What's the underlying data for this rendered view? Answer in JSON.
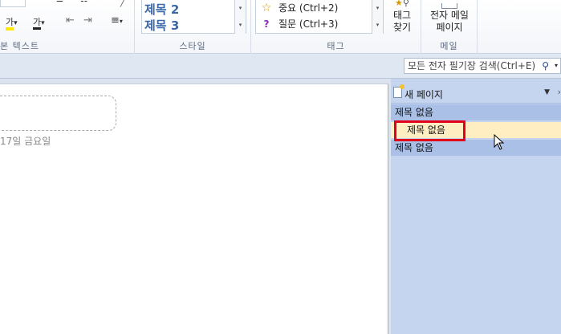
{
  "ribbon": {
    "basic_text": {
      "label": "본 텍스트",
      "highlight_glyph": "가",
      "fontcolor_glyph": "가",
      "dropdown": "▾"
    },
    "styles": {
      "label": "스타일",
      "items": [
        "제목 2",
        "제목 3"
      ]
    },
    "tags": {
      "label": "태그",
      "items": [
        {
          "icon": "star-icon",
          "glyph": "☆",
          "text": "중요 (Ctrl+2)",
          "color": "#d49a00"
        },
        {
          "icon": "question-icon",
          "glyph": "?",
          "text": "질문 (Ctrl+3)",
          "color": "#8b2bb8"
        }
      ],
      "find_tags": [
        "태그",
        "찾기"
      ]
    },
    "email": {
      "label": "메일",
      "button": [
        "전자 메일",
        "페이지"
      ]
    }
  },
  "search": {
    "placeholder": "모든 전자 필기장 검색(Ctrl+E)",
    "icon": "search-icon"
  },
  "page": {
    "date_fragment": "17일 금요일"
  },
  "pages_pane": {
    "new_page": "새 페이지",
    "pages": [
      "제목 없음",
      "제목 없음",
      "제목 없음"
    ],
    "selected_index": 1
  },
  "accent": {
    "selected_bg": "#ffeec2",
    "highlight_border": "#e3001b",
    "pane_bg": "#c5d4ef"
  }
}
